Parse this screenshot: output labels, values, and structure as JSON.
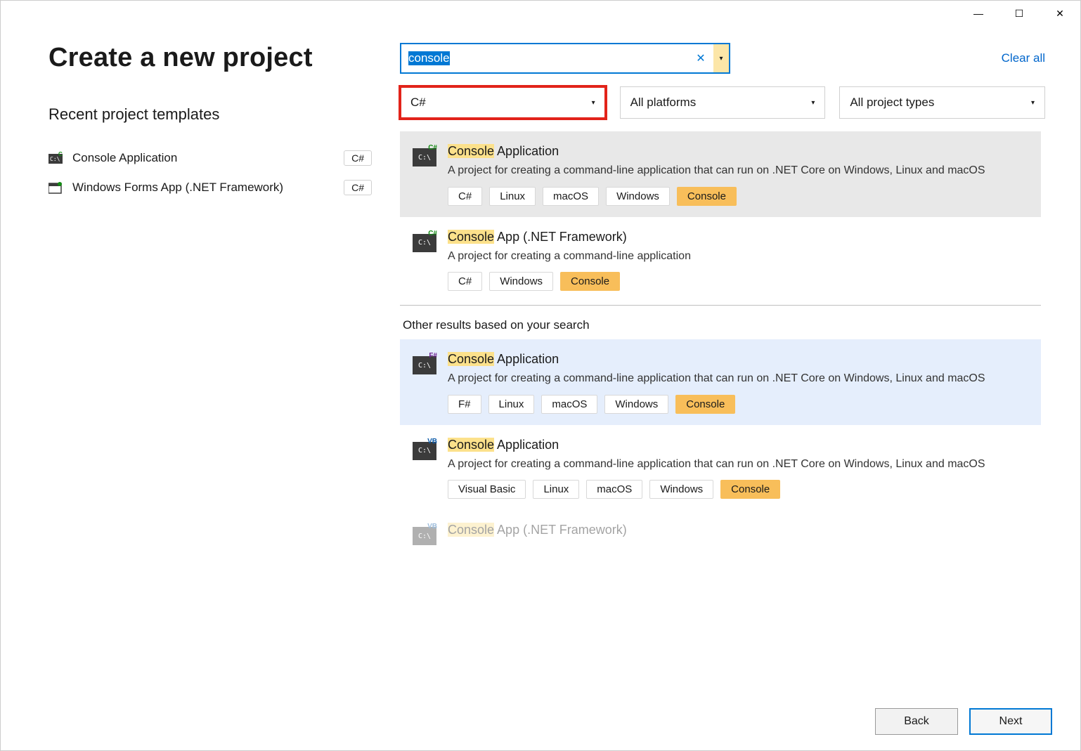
{
  "window": {
    "minimize": "—",
    "maximize": "☐",
    "close": "✕"
  },
  "header": {
    "title": "Create a new project",
    "recent_heading": "Recent project templates"
  },
  "recent": [
    {
      "label": "Console Application",
      "badge": "C#",
      "icon": "cs"
    },
    {
      "label": "Windows Forms App (.NET Framework)",
      "badge": "C#",
      "icon": "wf"
    }
  ],
  "search": {
    "value": "console",
    "clear_all": "Clear all"
  },
  "filters": {
    "language": "C#",
    "platform": "All platforms",
    "project_type": "All project types"
  },
  "templates": [
    {
      "highlight_prefix": "Console",
      "title_rest": " Application",
      "desc": "A project for creating a command-line application that can run on .NET Core on Windows, Linux and macOS",
      "lang": "cs",
      "tags": [
        "C#",
        "Linux",
        "macOS",
        "Windows"
      ],
      "hl_tag": "Console",
      "selected": true
    },
    {
      "highlight_prefix": "Console",
      "title_rest": " App (.NET Framework)",
      "desc": "A project for creating a command-line application",
      "lang": "cs",
      "tags": [
        "C#",
        "Windows"
      ],
      "hl_tag": "Console"
    }
  ],
  "other_heading": "Other results based on your search",
  "other_templates": [
    {
      "highlight_prefix": "Console",
      "title_rest": " Application",
      "desc": "A project for creating a command-line application that can run on .NET Core on Windows, Linux and macOS",
      "lang": "fs",
      "tags": [
        "F#",
        "Linux",
        "macOS",
        "Windows"
      ],
      "hl_tag": "Console",
      "blue": true
    },
    {
      "highlight_prefix": "Console",
      "title_rest": " Application",
      "desc": "A project for creating a command-line application that can run on .NET Core on Windows, Linux and macOS",
      "lang": "vb",
      "tags": [
        "Visual Basic",
        "Linux",
        "macOS",
        "Windows"
      ],
      "hl_tag": "Console"
    },
    {
      "highlight_prefix": "Console",
      "title_rest": " App (.NET Framework)",
      "desc": "",
      "lang": "vb",
      "tags": [],
      "hl_tag": "",
      "faded": true
    }
  ],
  "footer": {
    "back": "Back",
    "next": "Next"
  }
}
